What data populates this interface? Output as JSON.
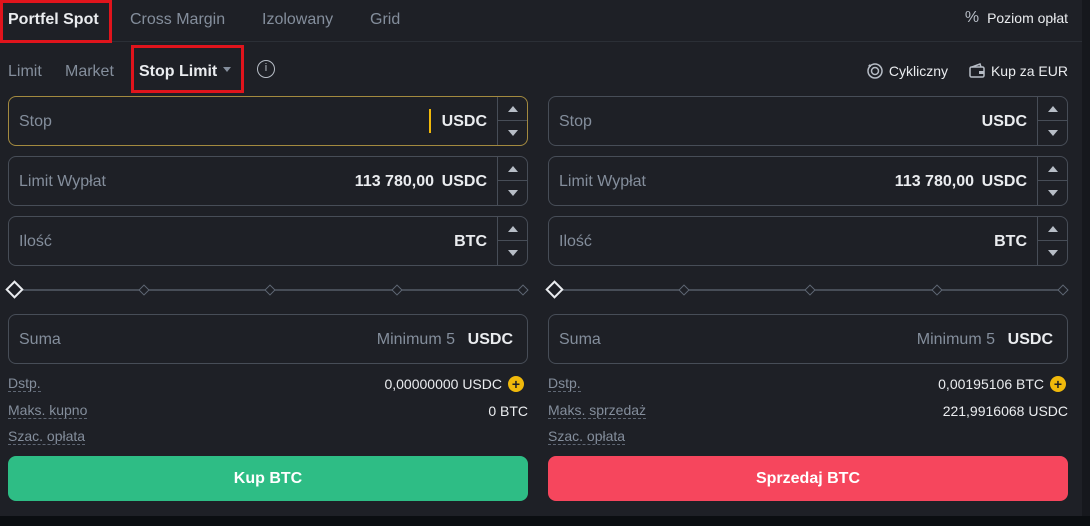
{
  "tabs": [
    {
      "label": "Portfel Spot",
      "active": true
    },
    {
      "label": "Cross Margin",
      "active": false
    },
    {
      "label": "Izolowany",
      "active": false
    },
    {
      "label": "Grid",
      "active": false
    }
  ],
  "fee_level": {
    "icon": "percent-icon",
    "label": "Poziom opłat"
  },
  "order_types": [
    {
      "label": "Limit",
      "active": false
    },
    {
      "label": "Market",
      "active": false
    },
    {
      "label": "Stop Limit",
      "active": true
    }
  ],
  "tools": {
    "recurring": {
      "icon": "recurring-icon",
      "label": "Cykliczny"
    },
    "buy_eur": {
      "icon": "wallet-icon",
      "label": "Kup za EUR"
    }
  },
  "buy": {
    "stop": {
      "label": "Stop",
      "value": "",
      "unit": "USDC"
    },
    "limit": {
      "label": "Limit Wypłat",
      "value": "113 780,00",
      "unit": "USDC"
    },
    "amount": {
      "label": "Ilość",
      "value": "",
      "unit": "BTC"
    },
    "total": {
      "label": "Suma",
      "placeholder": "Minimum 5",
      "unit": "USDC"
    },
    "slider_percent": 0,
    "available": {
      "label": "Dstp.",
      "value": "0,00000000 USDC"
    },
    "max": {
      "label": "Maks. kupno",
      "value": "0 BTC"
    },
    "fee": {
      "label": "Szac. opłata",
      "value": ""
    },
    "button": "Kup BTC"
  },
  "sell": {
    "stop": {
      "label": "Stop",
      "value": "",
      "unit": "USDC"
    },
    "limit": {
      "label": "Limit Wypłat",
      "value": "113 780,00",
      "unit": "USDC"
    },
    "amount": {
      "label": "Ilość",
      "value": "",
      "unit": "BTC"
    },
    "total": {
      "label": "Suma",
      "placeholder": "Minimum 5",
      "unit": "USDC"
    },
    "slider_percent": 0,
    "available": {
      "label": "Dstp.",
      "value": "0,00195106 BTC"
    },
    "max": {
      "label": "Maks. sprzedaż",
      "value": "221,9916068 USDC"
    },
    "fee": {
      "label": "Szac. opłata",
      "value": ""
    },
    "button": "Sprzedaj BTC"
  },
  "colors": {
    "background": "#1e2026",
    "buy": "#2ebd85",
    "sell": "#f6465d",
    "accent": "#f0b90b",
    "highlight": "#e0141c"
  }
}
